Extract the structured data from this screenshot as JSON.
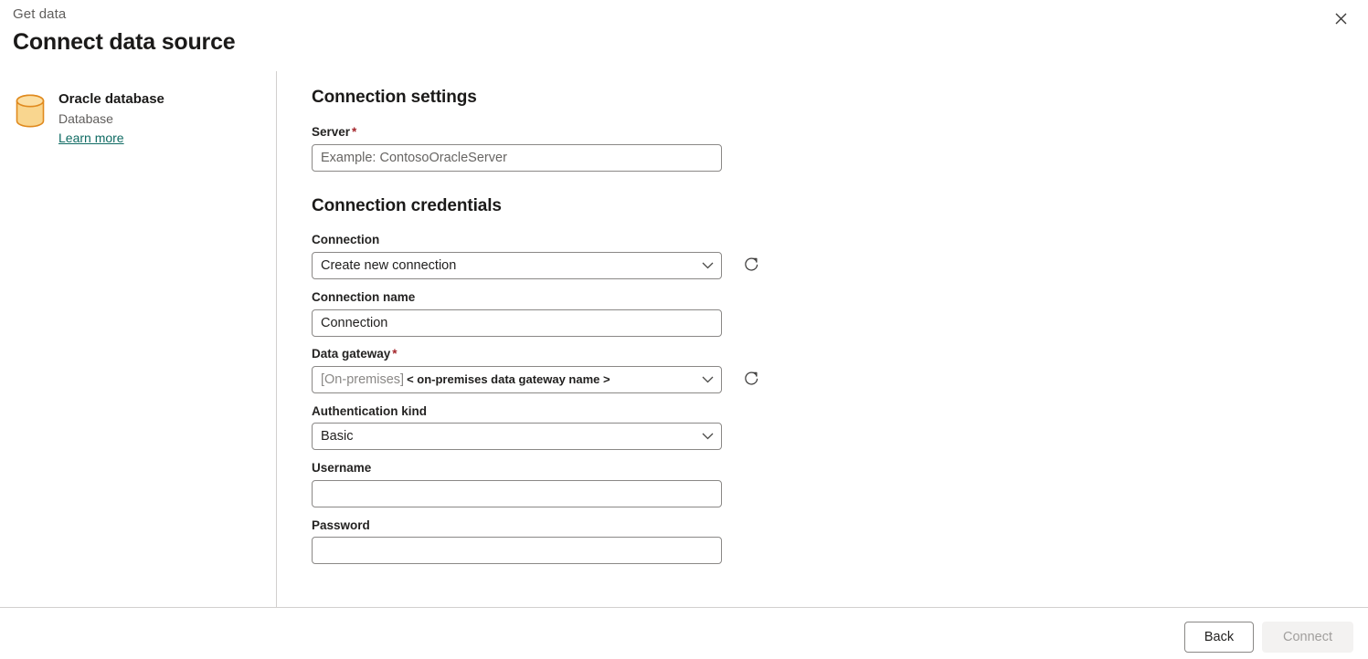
{
  "header": {
    "eyebrow": "Get data",
    "title": "Connect data source",
    "close_label": "Close"
  },
  "source": {
    "icon": "database-cylinder-icon",
    "name": "Oracle database",
    "type": "Database",
    "learn_more": "Learn more",
    "icon_color": "#f7cd7a",
    "icon_stroke": "#d97706"
  },
  "form": {
    "connection_settings_title": "Connection settings",
    "server": {
      "label": "Server",
      "required_marker": "*",
      "value": "",
      "placeholder": "Example: ContosoOracleServer"
    },
    "connection_credentials_title": "Connection credentials",
    "connection": {
      "label": "Connection",
      "value": "Create new connection",
      "refresh_icon": "refresh-icon"
    },
    "connection_name": {
      "label": "Connection name",
      "value": "Connection",
      "placeholder": ""
    },
    "data_gateway": {
      "label": "Data gateway",
      "required_marker": "*",
      "value_prefix": "[On-premises]",
      "value_name": "< on-premises data gateway name >",
      "refresh_icon": "refresh-icon"
    },
    "authentication_kind": {
      "label": "Authentication kind",
      "value": "Basic"
    },
    "username": {
      "label": "Username",
      "value": "",
      "placeholder": ""
    },
    "password": {
      "label": "Password",
      "value": "",
      "placeholder": ""
    }
  },
  "footer": {
    "back_label": "Back",
    "connect_label": "Connect"
  },
  "colors": {
    "required_asterisk": "#a4262c",
    "link": "#0f6b63",
    "border": "#8a8886",
    "divider": "#d2d0ce"
  }
}
